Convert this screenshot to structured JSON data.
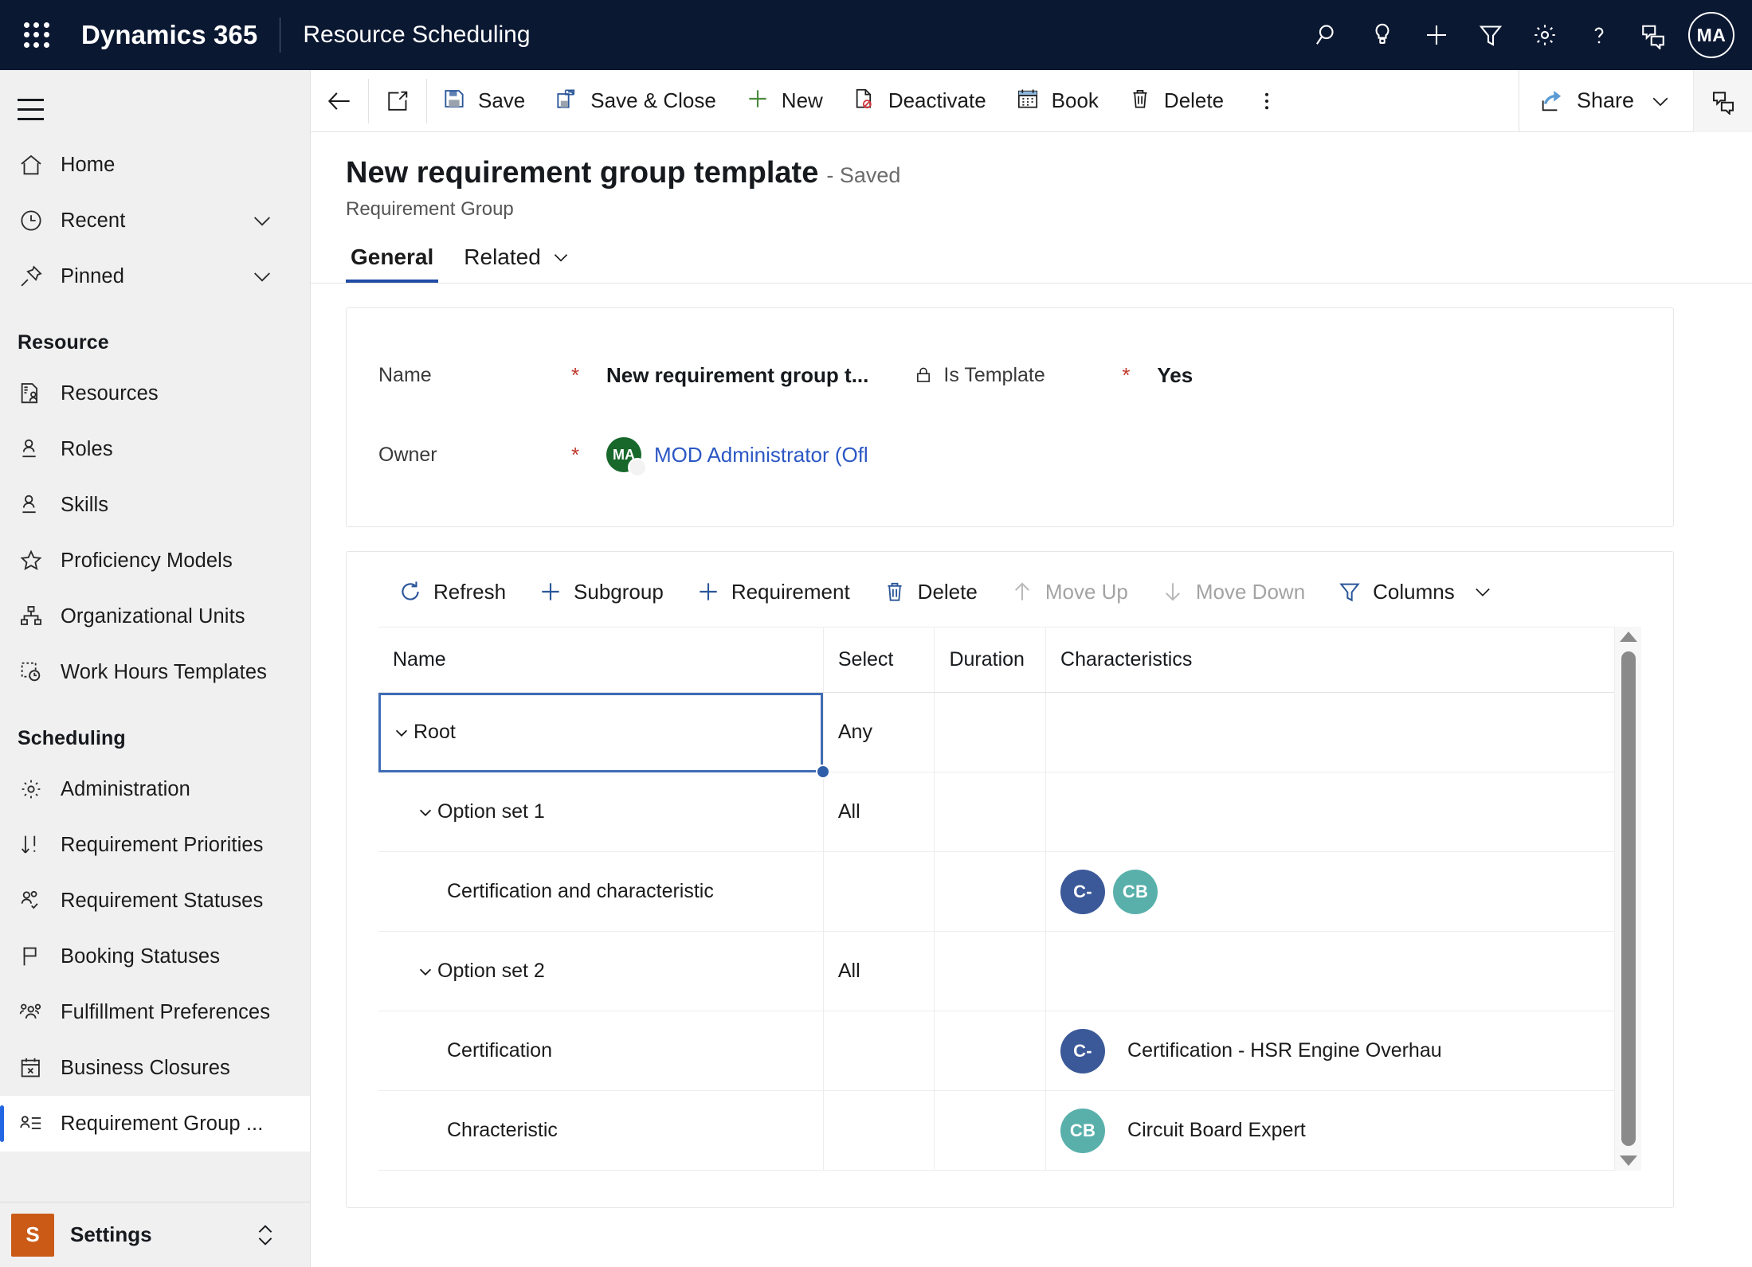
{
  "appbar": {
    "waffle_icon": "app-launcher-icon",
    "brand": "Dynamics 365",
    "app_name": "Resource Scheduling",
    "icons": [
      {
        "name": "search-icon",
        "label": "Search"
      },
      {
        "name": "lightbulb-icon",
        "label": "Insights"
      },
      {
        "name": "plus-icon",
        "label": "New"
      },
      {
        "name": "filter-icon",
        "label": "Filter"
      },
      {
        "name": "gear-icon",
        "label": "Settings"
      },
      {
        "name": "help-icon",
        "label": "Help"
      },
      {
        "name": "feedback-icon",
        "label": "Feedback"
      }
    ],
    "avatar_initials": "MA"
  },
  "sidebar": {
    "hamburger_label": "Site map",
    "top_items": [
      {
        "label": "Home",
        "icon": "home-icon",
        "chevron": false
      },
      {
        "label": "Recent",
        "icon": "clock-icon",
        "chevron": true
      },
      {
        "label": "Pinned",
        "icon": "pin-icon",
        "chevron": true
      }
    ],
    "groups": [
      {
        "title": "Resource",
        "items": [
          {
            "label": "Resources",
            "icon": "resource-card-icon"
          },
          {
            "label": "Roles",
            "icon": "person-underline-icon"
          },
          {
            "label": "Skills",
            "icon": "person-underline-icon"
          },
          {
            "label": "Proficiency Models",
            "icon": "star-icon"
          },
          {
            "label": "Organizational Units",
            "icon": "org-chart-icon"
          },
          {
            "label": "Work Hours Templates",
            "icon": "dashed-clock-icon"
          }
        ]
      },
      {
        "title": "Scheduling",
        "items": [
          {
            "label": "Administration",
            "icon": "gear-icon"
          },
          {
            "label": "Requirement Priorities",
            "icon": "sort-priority-icon"
          },
          {
            "label": "Requirement Statuses",
            "icon": "people-check-icon"
          },
          {
            "label": "Booking Statuses",
            "icon": "flag-icon"
          },
          {
            "label": "Fulfillment Preferences",
            "icon": "people-group-icon"
          },
          {
            "label": "Business Closures",
            "icon": "calendar-x-icon"
          },
          {
            "label": "Requirement Group ...",
            "icon": "person-list-icon",
            "selected": true
          }
        ]
      }
    ],
    "footer": {
      "tile_letter": "S",
      "label": "Settings",
      "expander_icon": "up-down-chevron-icon"
    },
    "selected_accent": "#2266e3",
    "settings_tile_color": "#ca5a16"
  },
  "commandbar": {
    "back_icon": "back-arrow-icon",
    "popout_icon": "open-in-new-window-icon",
    "buttons": [
      {
        "label": "Save",
        "icon": "save-icon",
        "disabled": false
      },
      {
        "label": "Save & Close",
        "icon": "save-close-icon",
        "disabled": false
      },
      {
        "label": "New",
        "icon": "plus-icon",
        "disabled": false
      },
      {
        "label": "Deactivate",
        "icon": "deactivate-icon",
        "disabled": false
      },
      {
        "label": "Book",
        "icon": "calendar-icon",
        "disabled": false
      },
      {
        "label": "Delete",
        "icon": "trash-icon",
        "disabled": false
      }
    ],
    "overflow_icon": "more-vertical-icon",
    "share_label": "Share",
    "share_icon": "share-icon",
    "share_chevron_icon": "chevron-down-icon",
    "assistant_icon": "assistant-panel-icon"
  },
  "record": {
    "title": "New requirement group template",
    "saved_state": "- Saved",
    "entity": "Requirement Group"
  },
  "tabs": [
    {
      "label": "General",
      "active": true,
      "chevron": false
    },
    {
      "label": "Related",
      "active": false,
      "chevron": true
    }
  ],
  "form": {
    "name": {
      "label": "Name",
      "required_marker": "*",
      "value": "New requirement group t..."
    },
    "is_template": {
      "label": "Is Template",
      "lock_icon": "lock-icon",
      "required_marker": "*",
      "value": "Yes"
    },
    "owner": {
      "label": "Owner",
      "required_marker": "*",
      "avatar_initials": "MA",
      "value": "MOD Administrator (Ofl"
    }
  },
  "grid_toolbar": [
    {
      "label": "Refresh",
      "icon": "refresh-icon",
      "disabled": false
    },
    {
      "label": "Subgroup",
      "icon": "plus-icon",
      "disabled": false
    },
    {
      "label": "Requirement",
      "icon": "plus-icon",
      "disabled": false
    },
    {
      "label": "Delete",
      "icon": "trash-icon",
      "disabled": false
    },
    {
      "label": "Move Up",
      "icon": "arrow-up-icon",
      "disabled": true
    },
    {
      "label": "Move Down",
      "icon": "arrow-down-icon",
      "disabled": true
    },
    {
      "label": "Columns",
      "icon": "filter-icon",
      "disabled": false,
      "chevron": true
    }
  ],
  "grid": {
    "columns": [
      "Name",
      "Select",
      "Duration",
      "Characteristics"
    ],
    "rows": [
      {
        "name": "Root",
        "indent": 0,
        "twisty": true,
        "selected": true,
        "select": "Any",
        "duration": "",
        "chips": [],
        "chip_text": ""
      },
      {
        "name": "Option set 1",
        "indent": 1,
        "twisty": true,
        "selected": false,
        "select": "All",
        "duration": "",
        "chips": [],
        "chip_text": ""
      },
      {
        "name": "Certification and characteristic",
        "indent": 2,
        "twisty": false,
        "selected": false,
        "select": "",
        "duration": "",
        "chips": [
          {
            "initials": "C-",
            "color": "#3b5998"
          },
          {
            "initials": "CB",
            "color": "#59b0ab"
          }
        ],
        "chip_text": ""
      },
      {
        "name": "Option set 2",
        "indent": 1,
        "twisty": true,
        "selected": false,
        "select": "All",
        "duration": "",
        "chips": [],
        "chip_text": ""
      },
      {
        "name": "Certification",
        "indent": 2,
        "twisty": false,
        "selected": false,
        "select": "",
        "duration": "",
        "chips": [
          {
            "initials": "C-",
            "color": "#3b5998"
          }
        ],
        "chip_text": "Certification - HSR Engine Overhau"
      },
      {
        "name": "Chracteristic",
        "indent": 2,
        "twisty": false,
        "selected": false,
        "select": "",
        "duration": "",
        "chips": [
          {
            "initials": "CB",
            "color": "#59b0ab"
          }
        ],
        "chip_text": "Circuit Board Expert"
      }
    ],
    "scrollbar": {
      "up_icon": "scroll-up-arrow-icon",
      "down_icon": "scroll-down-arrow-icon"
    }
  },
  "colors": {
    "appbar_bg": "#0b1832",
    "tab_accent": "#1f4ba5",
    "link": "#2b57c4",
    "required": "#c0392b"
  }
}
